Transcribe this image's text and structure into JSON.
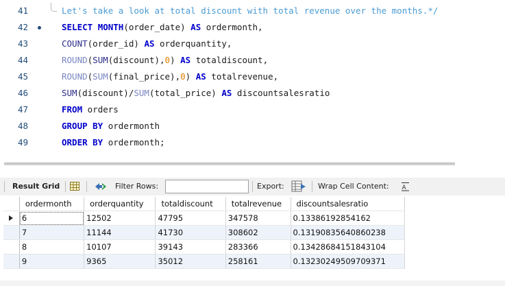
{
  "editor": {
    "lines": [
      {
        "num": "41",
        "dot": false
      },
      {
        "num": "42",
        "dot": true
      },
      {
        "num": "43",
        "dot": false
      },
      {
        "num": "44",
        "dot": false
      },
      {
        "num": "45",
        "dot": false
      },
      {
        "num": "46",
        "dot": false
      },
      {
        "num": "47",
        "dot": false
      },
      {
        "num": "48",
        "dot": false
      },
      {
        "num": "49",
        "dot": false
      }
    ],
    "t": {
      "l41_comment": "Let's take a look at total discount with total revenue over the months.*/",
      "select": "SELECT",
      "month": "MONTH",
      "order_date": "(order_date)",
      "as": "AS",
      "ordermonth_c": "ordermonth,",
      "count": "COUNT",
      "order_id": "(order_id)",
      "orderquantity_c": "orderquantity,",
      "round": "ROUND",
      "sum": "SUM",
      "paren_open": "(",
      "discount_arg": "(discount),",
      "zero": "0",
      "paren_close": ")",
      "totaldiscount_c": "totaldiscount,",
      "final_price_arg": "(final_price),",
      "totalrevenue_c": "totalrevenue,",
      "discount_div": "(discount)/",
      "total_price_arg": "(total_price)",
      "discountsalesratio": "discountsalesratio",
      "from": "FROM",
      "orders": "orders",
      "group_by": "GROUP BY",
      "ordermonth": "ordermonth",
      "order_by": "ORDER BY",
      "ordermonth_semi": "ordermonth;"
    }
  },
  "toolbar": {
    "result_grid": "Result Grid",
    "filter_rows": "Filter Rows:",
    "filter_value": "",
    "export": "Export:",
    "wrap_cell_content": "Wrap Cell Content:",
    "icons": [
      "grid-view-icon",
      "filter-icon",
      "export-icon",
      "wrap-text-icon"
    ]
  },
  "grid": {
    "columns": [
      "ordermonth",
      "orderquantity",
      "totaldiscount",
      "totalrevenue",
      "discountsalesratio"
    ],
    "rows": [
      [
        "6",
        "12502",
        "47795",
        "347578",
        "0.13386192854162"
      ],
      [
        "7",
        "11144",
        "41730",
        "308602",
        "0.13190835640860238"
      ],
      [
        "8",
        "10107",
        "39143",
        "283366",
        "0.13428684151843104"
      ],
      [
        "9",
        "9365",
        "35012",
        "258161",
        "0.13230249509709371"
      ]
    ]
  },
  "colors": {
    "keyword": "#0000cc",
    "function": "#2b2b8a",
    "number": "#e07b00",
    "comment": "#4a9bd3",
    "line_number": "#1f4b79",
    "alt_row": "#eef3fb"
  }
}
